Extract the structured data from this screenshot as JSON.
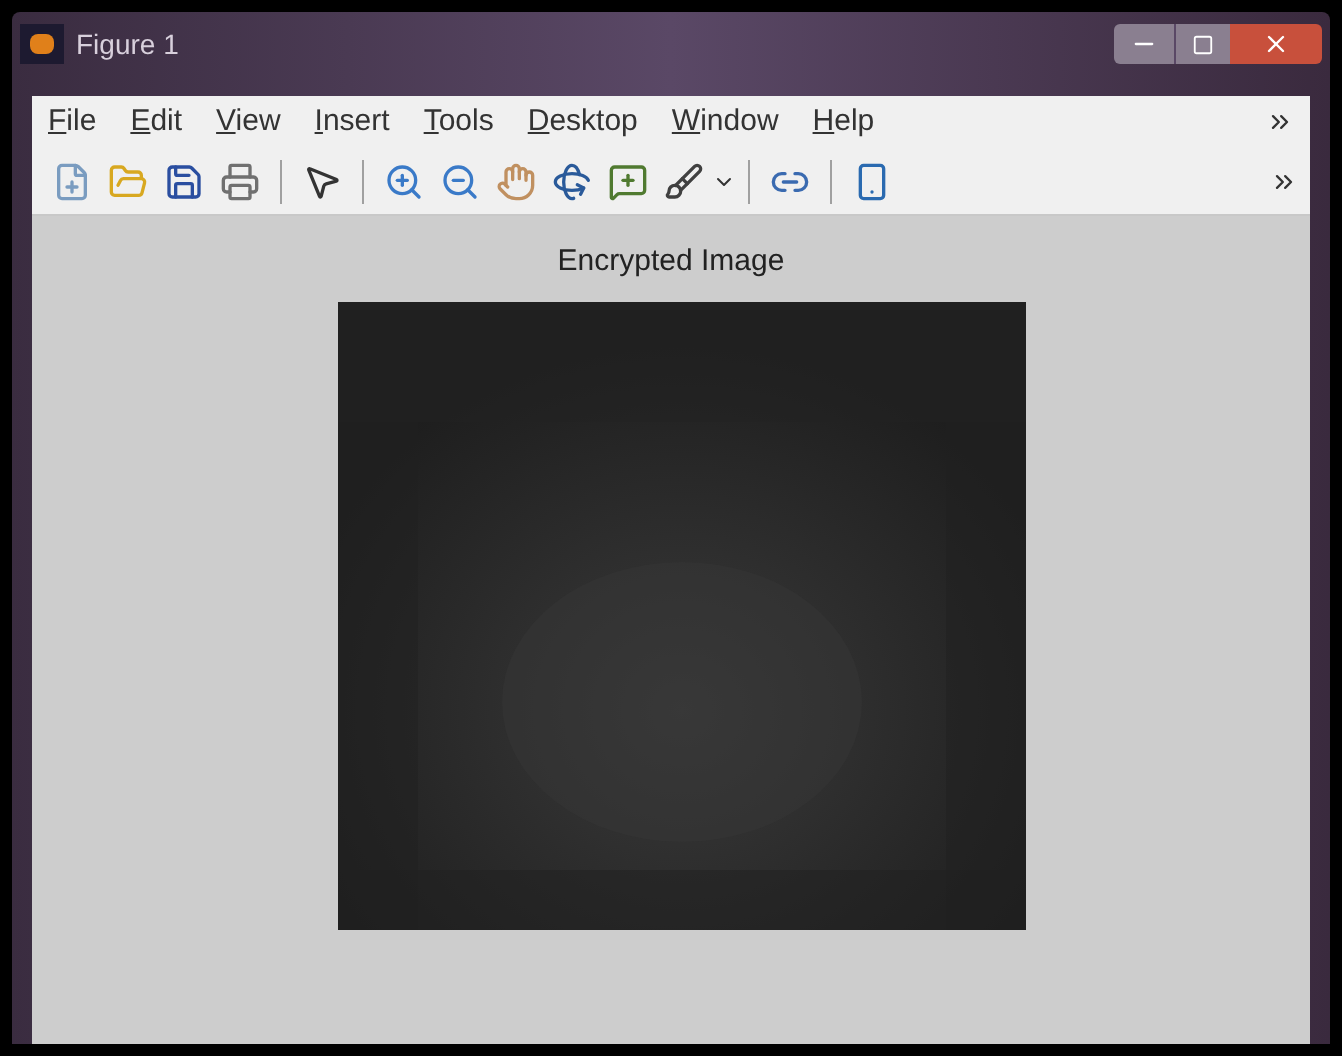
{
  "window": {
    "title": "Figure 1"
  },
  "menu": [
    "File",
    "Edit",
    "View",
    "Insert",
    "Tools",
    "Desktop",
    "Window",
    "Help"
  ],
  "figure": {
    "axes_title": "Encrypted Image"
  }
}
